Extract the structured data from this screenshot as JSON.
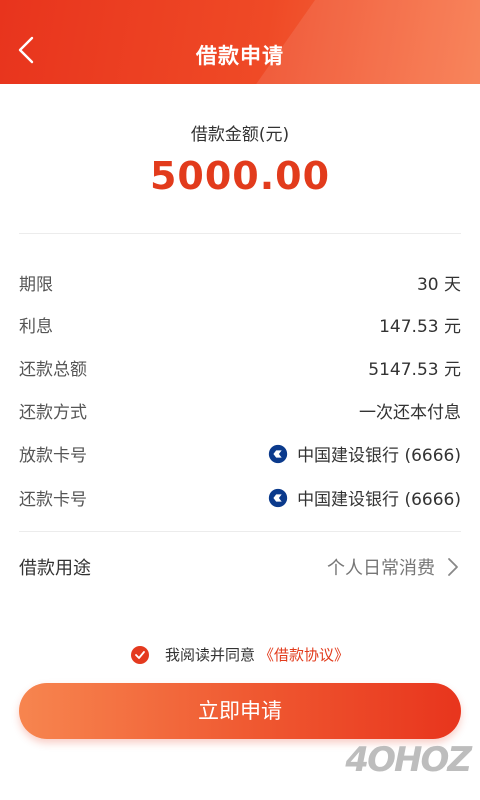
{
  "header": {
    "title": "借款申请"
  },
  "amount": {
    "label": "借款金额(元)",
    "value": "5000.00"
  },
  "details": [
    {
      "label": "期限",
      "value": "30 天"
    },
    {
      "label": "利息",
      "value": "147.53 元"
    },
    {
      "label": "还款总额",
      "value": "5147.53 元"
    },
    {
      "label": "还款方式",
      "value": "一次还本付息"
    },
    {
      "label": "放款卡号",
      "value": "中国建设银行 (6666)",
      "icon": "ccb-bank-icon"
    },
    {
      "label": "还款卡号",
      "value": "中国建设银行 (6666)",
      "icon": "ccb-bank-icon"
    }
  ],
  "purpose": {
    "label": "借款用途",
    "value": "个人日常消费"
  },
  "agreement": {
    "text": "我阅读并同意",
    "link": "《借款协议》",
    "checked": true
  },
  "submit": {
    "label": "立即申请"
  },
  "watermark": "4OHOZ",
  "colors": {
    "accent": "#e23b1c",
    "header": "#ef4a26",
    "bank_icon": "#0b3a8c"
  }
}
